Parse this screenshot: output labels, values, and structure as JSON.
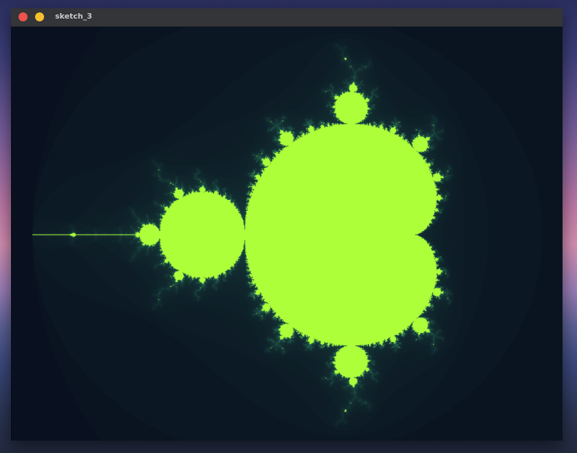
{
  "window": {
    "title": "sketch_3",
    "buttons": {
      "close_icon": "close-icon",
      "minimize_icon": "minimize-icon"
    }
  },
  "sketch": {
    "fractal": "mandelbrot",
    "colors": {
      "background": "#06071a",
      "set": "#adff3a",
      "glow": "#2f8a66"
    }
  }
}
